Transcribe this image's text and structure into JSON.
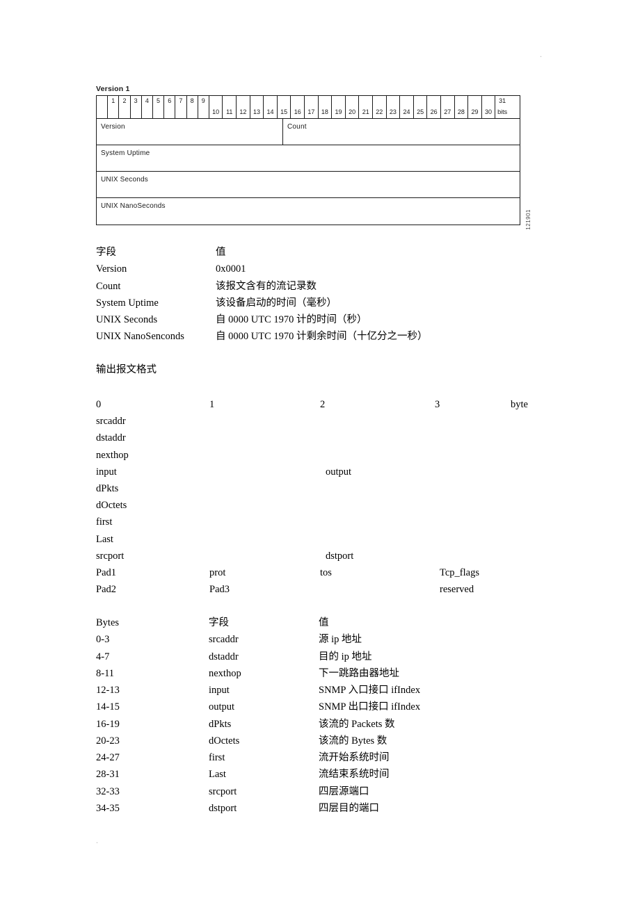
{
  "page_marks": {
    "top_right": ".",
    "bottom_left": "."
  },
  "figure": {
    "caption": "Version 1",
    "figure_id": "121901",
    "bit_ruler": {
      "cells": [
        {
          "top": "",
          "bottom": "",
          "width": "narrow"
        },
        {
          "top": "1",
          "bottom": "",
          "width": "narrow"
        },
        {
          "top": "2",
          "bottom": "",
          "width": "narrow"
        },
        {
          "top": "3",
          "bottom": "",
          "width": "narrow"
        },
        {
          "top": "4",
          "bottom": "",
          "width": "narrow"
        },
        {
          "top": "5",
          "bottom": "",
          "width": "narrow"
        },
        {
          "top": "6",
          "bottom": "",
          "width": "narrow"
        },
        {
          "top": "7",
          "bottom": "",
          "width": "narrow"
        },
        {
          "top": "8",
          "bottom": "",
          "width": "narrow"
        },
        {
          "top": "9",
          "bottom": "",
          "width": "narrow"
        },
        {
          "top": "",
          "bottom": "10",
          "width": "wide"
        },
        {
          "top": "",
          "bottom": "11",
          "width": "wide"
        },
        {
          "top": "",
          "bottom": "12",
          "width": "wide"
        },
        {
          "top": "",
          "bottom": "13",
          "width": "wide"
        },
        {
          "top": "",
          "bottom": "14",
          "width": "wide"
        },
        {
          "top": "",
          "bottom": "15",
          "width": "wide"
        },
        {
          "top": "",
          "bottom": "16",
          "width": "wide"
        },
        {
          "top": "",
          "bottom": "17",
          "width": "wide"
        },
        {
          "top": "",
          "bottom": "18",
          "width": "wide"
        },
        {
          "top": "",
          "bottom": "19",
          "width": "wide"
        },
        {
          "top": "",
          "bottom": "20",
          "width": "wide"
        },
        {
          "top": "",
          "bottom": "21",
          "width": "wide"
        },
        {
          "top": "",
          "bottom": "22",
          "width": "wide"
        },
        {
          "top": "",
          "bottom": "23",
          "width": "wide"
        },
        {
          "top": "",
          "bottom": "24",
          "width": "wide"
        },
        {
          "top": "",
          "bottom": "25",
          "width": "wide"
        },
        {
          "top": "",
          "bottom": "26",
          "width": "wide"
        },
        {
          "top": "",
          "bottom": "27",
          "width": "wide"
        },
        {
          "top": "",
          "bottom": "28",
          "width": "wide"
        },
        {
          "top": "",
          "bottom": "29",
          "width": "wide"
        },
        {
          "top": "",
          "bottom": "30",
          "width": "wide"
        },
        {
          "top": "31",
          "bottom": "bits",
          "width": "wide"
        }
      ]
    },
    "rows": [
      {
        "left": "Version",
        "right": "Count"
      },
      {
        "left": "System Uptime"
      },
      {
        "left": "UNIX Seconds"
      },
      {
        "left": "UNIX NanoSeconds"
      }
    ]
  },
  "header_table": {
    "rows": [
      {
        "field": "字段",
        "value": "值"
      },
      {
        "field": "Version",
        "value": "0x0001"
      },
      {
        "field": "Count",
        "value": "该报文含有的流记录数"
      },
      {
        "field": "System Uptime",
        "value": "该设备启动的时间（毫秒）"
      },
      {
        "field": "UNIX Seconds",
        "value": "自 0000 UTC 1970 计的时间（秒）"
      },
      {
        "field": "UNIX NanoSenconds",
        "value": "自 0000 UTC 1970 计剩余时间（十亿分之一秒）"
      }
    ]
  },
  "section": {
    "heading": "输出报文格式"
  },
  "flow_layout": {
    "ruler": {
      "b0": "0",
      "b1": "1",
      "b2": "2",
      "b3": "3",
      "unit": "byte"
    },
    "rows": [
      {
        "c0": "srcaddr"
      },
      {
        "c0": "dstaddr"
      },
      {
        "c0": "nexthop"
      },
      {
        "c0": "input",
        "c2b": "output"
      },
      {
        "c0": "dPkts"
      },
      {
        "c0": "dOctets"
      },
      {
        "c0": "first"
      },
      {
        "c0": "Last"
      },
      {
        "c0": "srcport",
        "c2b": "dstport"
      },
      {
        "c0": "Pad1",
        "c1": "prot",
        "c2": "tos",
        "c3": "Tcp_flags"
      },
      {
        "c0": "Pad2",
        "c1": "Pad3",
        "c3": "reserved"
      }
    ]
  },
  "bytes_table": {
    "rows": [
      {
        "bytes": "Bytes",
        "field": "字段",
        "value": "值"
      },
      {
        "bytes": "0-3",
        "field": "srcaddr",
        "value": "源 ip 地址"
      },
      {
        "bytes": "4-7",
        "field": "dstaddr",
        "value": "目的 ip 地址"
      },
      {
        "bytes": "8-11",
        "field": "nexthop",
        "value": "下一跳路由器地址"
      },
      {
        "bytes": "12-13",
        "field": "input",
        "value": "SNMP 入口接口 ifIndex"
      },
      {
        "bytes": "14-15",
        "field": "output",
        "value": "SNMP 出口接口 ifIndex"
      },
      {
        "bytes": "16-19",
        "field": "dPkts",
        "value": "该流的 Packets 数"
      },
      {
        "bytes": "20-23",
        "field": "dOctets",
        "value": "该流的 Bytes 数"
      },
      {
        "bytes": "24-27",
        "field": "first",
        "value": "流开始系统时间"
      },
      {
        "bytes": "28-31",
        "field": "Last",
        "value": "流结束系统时间"
      },
      {
        "bytes": "32-33",
        "field": "srcport",
        "value": "四层源端口"
      },
      {
        "bytes": "34-35",
        "field": "dstport",
        "value": "四层目的端口"
      }
    ]
  }
}
